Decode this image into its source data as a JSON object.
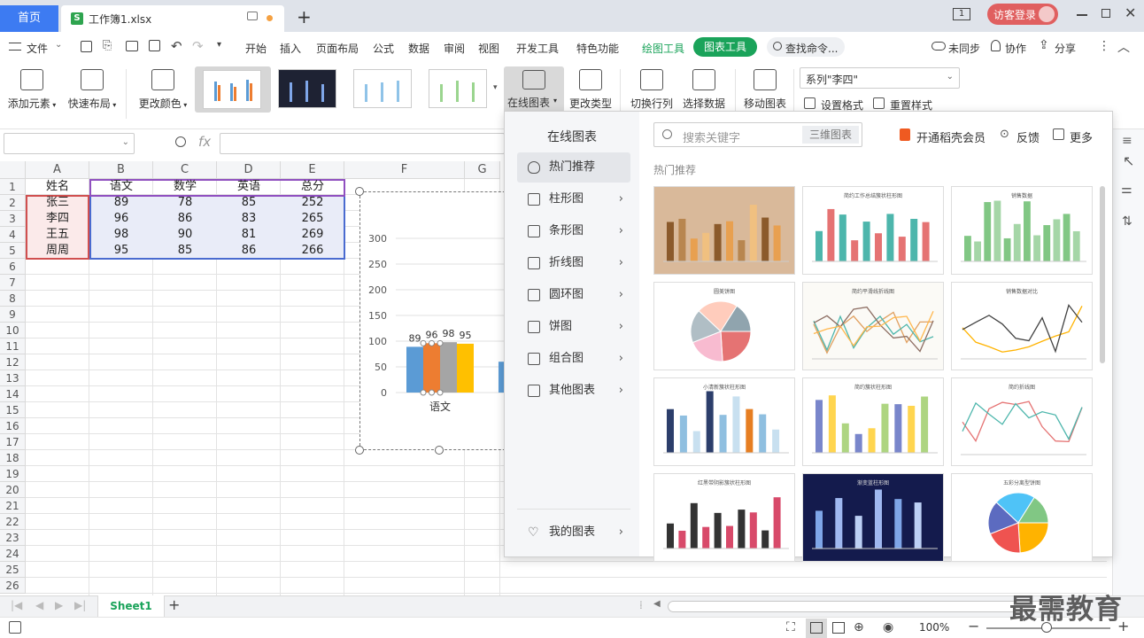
{
  "tabs": {
    "home": "首页",
    "file": "工作簿1.xlsx",
    "add": "+",
    "login": "访客登录",
    "badge": "1"
  },
  "menu": {
    "file": "文件",
    "items": [
      "开始",
      "插入",
      "页面布局",
      "公式",
      "数据",
      "审阅",
      "视图",
      "开发工具",
      "特色功能"
    ],
    "draw_tool": "绘图工具",
    "chart_tool": "图表工具",
    "search": "查找命令...",
    "sync": "未同步",
    "collab": "协作",
    "share": "分享"
  },
  "ribbon": {
    "add_element": "添加元素",
    "quick_layout": "快速布局",
    "change_color": "更改颜色",
    "online_chart": "在线图表",
    "change_type": "更改类型",
    "switch_rowcol": "切换行列",
    "select_data": "选择数据",
    "move_chart": "移动图表",
    "series_select": "系列\"李四\"",
    "set_format": "设置格式",
    "reset_style": "重置样式"
  },
  "formula": {
    "fx": "fx"
  },
  "sheet": {
    "columns": [
      "A",
      "B",
      "C",
      "D",
      "E",
      "F",
      "G"
    ],
    "rows": [
      "1",
      "2",
      "3",
      "4",
      "5",
      "6",
      "7",
      "8",
      "9",
      "10",
      "11",
      "12",
      "13",
      "14",
      "15",
      "16",
      "17",
      "18",
      "19",
      "20",
      "21",
      "22",
      "23",
      "24",
      "25",
      "26"
    ],
    "header": [
      "姓名",
      "语文",
      "数学",
      "英语",
      "总分"
    ],
    "data": [
      [
        "张三",
        "89",
        "78",
        "85",
        "252"
      ],
      [
        "李四",
        "96",
        "86",
        "83",
        "265"
      ],
      [
        "王五",
        "98",
        "90",
        "81",
        "269"
      ],
      [
        "周周",
        "95",
        "85",
        "86",
        "266"
      ]
    ],
    "tab": "Sheet1"
  },
  "chart_data": {
    "type": "bar",
    "categories": [
      "语文"
    ],
    "series": [
      {
        "values": [
          89
        ]
      },
      {
        "values": [
          96
        ]
      },
      {
        "values": [
          98
        ]
      },
      {
        "values": [
          95
        ]
      }
    ],
    "colors": [
      "#5b9bd5",
      "#ed7d31",
      "#a5a5a5",
      "#ffc000"
    ],
    "yticks": [
      "300",
      "250",
      "200",
      "150",
      "100",
      "50",
      "0"
    ],
    "ylim": [
      0,
      300
    ]
  },
  "panel": {
    "title": "在线图表",
    "search_placeholder": "搜索关键字",
    "tag": "三维图表",
    "vip": "开通稻壳会员",
    "feedback": "反馈",
    "more": "更多",
    "section": "热门推荐",
    "categories": [
      "热门推荐",
      "柱形图",
      "条形图",
      "折线图",
      "圆环图",
      "饼图",
      "组合图",
      "其他图表"
    ],
    "my_charts": "我的图表",
    "cards": [
      "",
      "简约工作总结簇状柱形图",
      "销售数据",
      "圆美饼图",
      "简约平滑线折线图",
      "销售数据对比",
      "小清新簇状柱形图",
      "简约簇状柱形图",
      "简约折线图",
      "红黑带阴影簇状柱形图",
      "渐变蓝柱形图",
      "五彩分离型饼图"
    ]
  },
  "status": {
    "zoom": "100%"
  },
  "watermark": "最需教育"
}
